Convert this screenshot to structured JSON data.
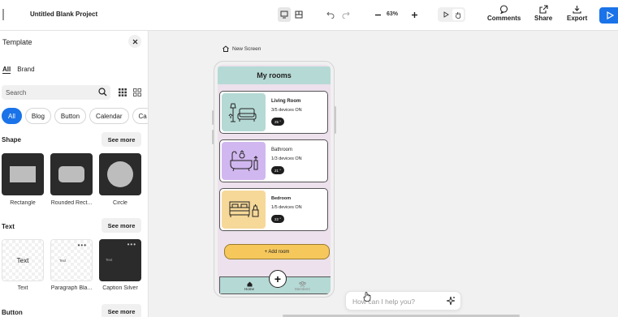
{
  "topbar": {
    "project_title": "Untitled Blank Project",
    "zoom": "63%",
    "comments_label": "Comments",
    "share_label": "Share",
    "export_label": "Export"
  },
  "panel": {
    "title": "Template",
    "tabs": [
      "All",
      "Brand"
    ],
    "search_placeholder": "Search",
    "chips": [
      "All",
      "Blog",
      "Button",
      "Calendar",
      "Ca"
    ],
    "see_more": "See more",
    "sections": {
      "shape": {
        "title": "Shape",
        "items": [
          "Rectangle",
          "Rounded Rect...",
          "Circle"
        ]
      },
      "text": {
        "title": "Text",
        "items": [
          "Text",
          "Paragraph Bla...",
          "Caption Silver"
        ],
        "tile_texts": [
          "Text",
          "Text",
          "Text"
        ]
      },
      "button": {
        "title": "Button"
      }
    }
  },
  "canvas": {
    "screen_label": "New Screen",
    "app": {
      "header": "My rooms",
      "rooms": [
        {
          "name": "Living Room",
          "devices": "3/5 devices ON",
          "temp": "25 °",
          "color": "#b5d9d5"
        },
        {
          "name": "Bathroom",
          "devices": "1/3 devices ON",
          "temp": "21 °",
          "color": "#d1b7ef"
        },
        {
          "name": "Bedroom",
          "devices": "1/5 devices ON",
          "temp": "22 °",
          "color": "#f6d899"
        }
      ],
      "add_room": "+ Add room",
      "fab": "+",
      "nav": {
        "home": "Home",
        "members": "Members"
      }
    },
    "ai_placeholder": "How can I help you?"
  },
  "colors": {
    "accent": "#1a73e8",
    "header_teal": "#b5d9d5",
    "phone_bg": "#ece1ec",
    "add_yellow": "#f6c85c"
  }
}
